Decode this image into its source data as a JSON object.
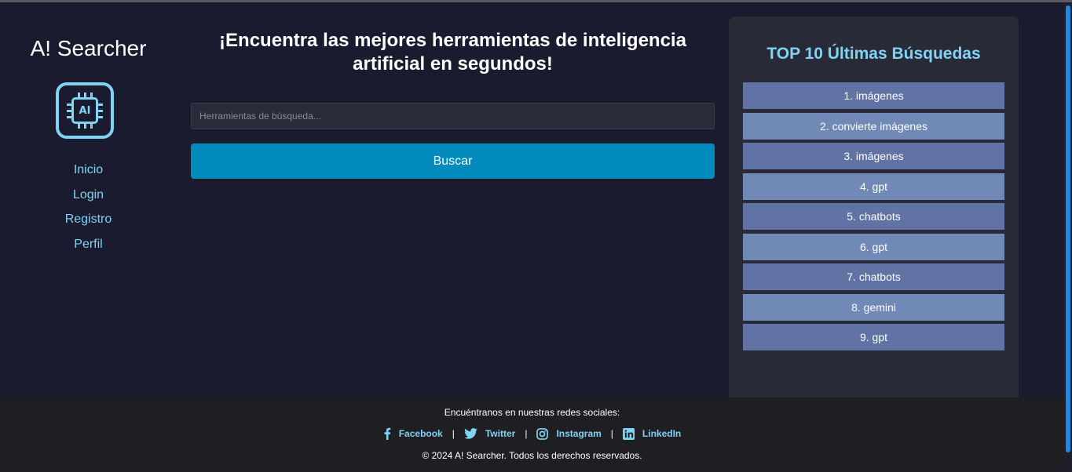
{
  "brand": {
    "title": "A! Searcher",
    "logo_text": "AI"
  },
  "nav": [
    {
      "label": "Inicio"
    },
    {
      "label": "Login"
    },
    {
      "label": "Registro"
    },
    {
      "label": "Perfil"
    }
  ],
  "main": {
    "headline": "¡Encuentra las mejores herramientas de inteligencia artificial en segundos!",
    "search_placeholder": "Herramientas de búsqueda...",
    "search_value": "",
    "button_label": "Buscar"
  },
  "top": {
    "title": "TOP 10 Últimas Búsquedas",
    "items": [
      "1. imágenes",
      "2. convierte imágenes",
      "3. imágenes",
      "4. gpt",
      "5. chatbots",
      "6. gpt",
      "7. chatbots",
      "8. gemini",
      "9. gpt"
    ]
  },
  "footer": {
    "title": "Encuéntranos en nuestras redes sociales:",
    "social": [
      {
        "label": "Facebook",
        "icon": "facebook-icon"
      },
      {
        "label": "Twitter",
        "icon": "twitter-icon"
      },
      {
        "label": "Instagram",
        "icon": "instagram-icon"
      },
      {
        "label": "LinkedIn",
        "icon": "linkedin-icon"
      }
    ],
    "separator": "|",
    "copyright": "© 2024 A! Searcher. Todos los derechos reservados."
  },
  "colors": {
    "background": "#1a1b2e",
    "accent": "#7fd3f3",
    "button": "#008bbd",
    "item_dark": "#6172a5",
    "item_light": "#7089b6"
  }
}
